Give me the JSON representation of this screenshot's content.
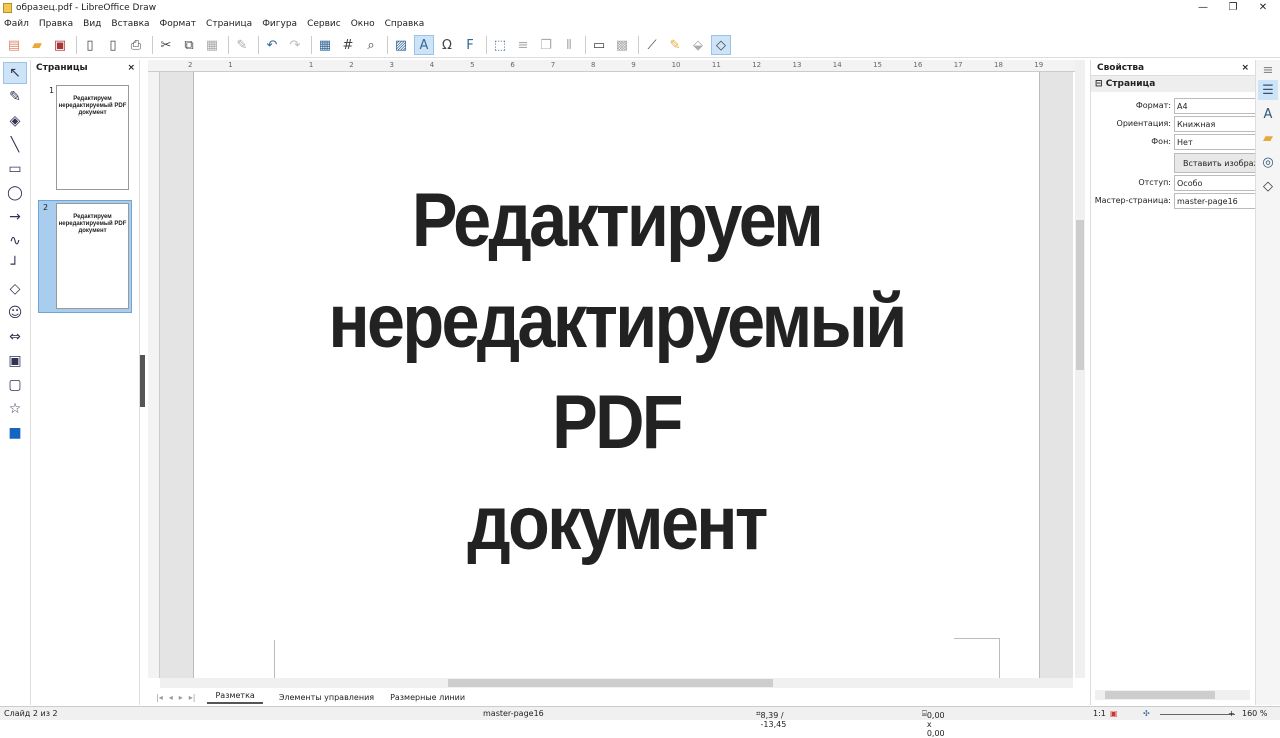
{
  "window": {
    "title": "образец.pdf - LibreOffice Draw",
    "minimize": "—",
    "maximize": "❐",
    "close": "✕"
  },
  "menu": [
    "Файл",
    "Правка",
    "Вид",
    "Вставка",
    "Формат",
    "Страница",
    "Фигура",
    "Сервис",
    "Окно",
    "Справка"
  ],
  "pages_panel": {
    "title": "Страницы",
    "close": "×",
    "pages": [
      {
        "num": "1",
        "text": "Редактируем нередактируемый PDF документ"
      },
      {
        "num": "2",
        "text": "Редактируем нередактируемый PDF документ"
      }
    ]
  },
  "document": {
    "lines": [
      "Редактируем",
      "нередактируемый",
      "PDF",
      "документ"
    ]
  },
  "ruler": [
    "2",
    "1",
    "",
    "1",
    "2",
    "3",
    "4",
    "5",
    "6",
    "7",
    "8",
    "9",
    "10",
    "11",
    "12",
    "13",
    "14",
    "15",
    "16",
    "17",
    "18",
    "19"
  ],
  "layer_tabs": [
    "Разметка",
    "Элементы управления",
    "Размерные линии"
  ],
  "sidebar": {
    "title": "Свойства",
    "close": "×",
    "section": "Страница",
    "fields": [
      {
        "label": "Формат:",
        "value": "A4"
      },
      {
        "label": "Ориентация:",
        "value": "Книжная"
      },
      {
        "label": "Фон:",
        "value": "Нет"
      }
    ],
    "insert_image": "Вставить изображение",
    "margin": {
      "label": "Отступ:",
      "value": "Особо"
    },
    "master": {
      "label": "Мастер-страница:",
      "value": "master-page16"
    }
  },
  "status": {
    "slide": "Слайд 2 из 2",
    "master": "master-page16",
    "position": "8,39 / -13,45",
    "size": "0,00 x 0,00",
    "scale": "1:1",
    "zoom": "160 %"
  }
}
